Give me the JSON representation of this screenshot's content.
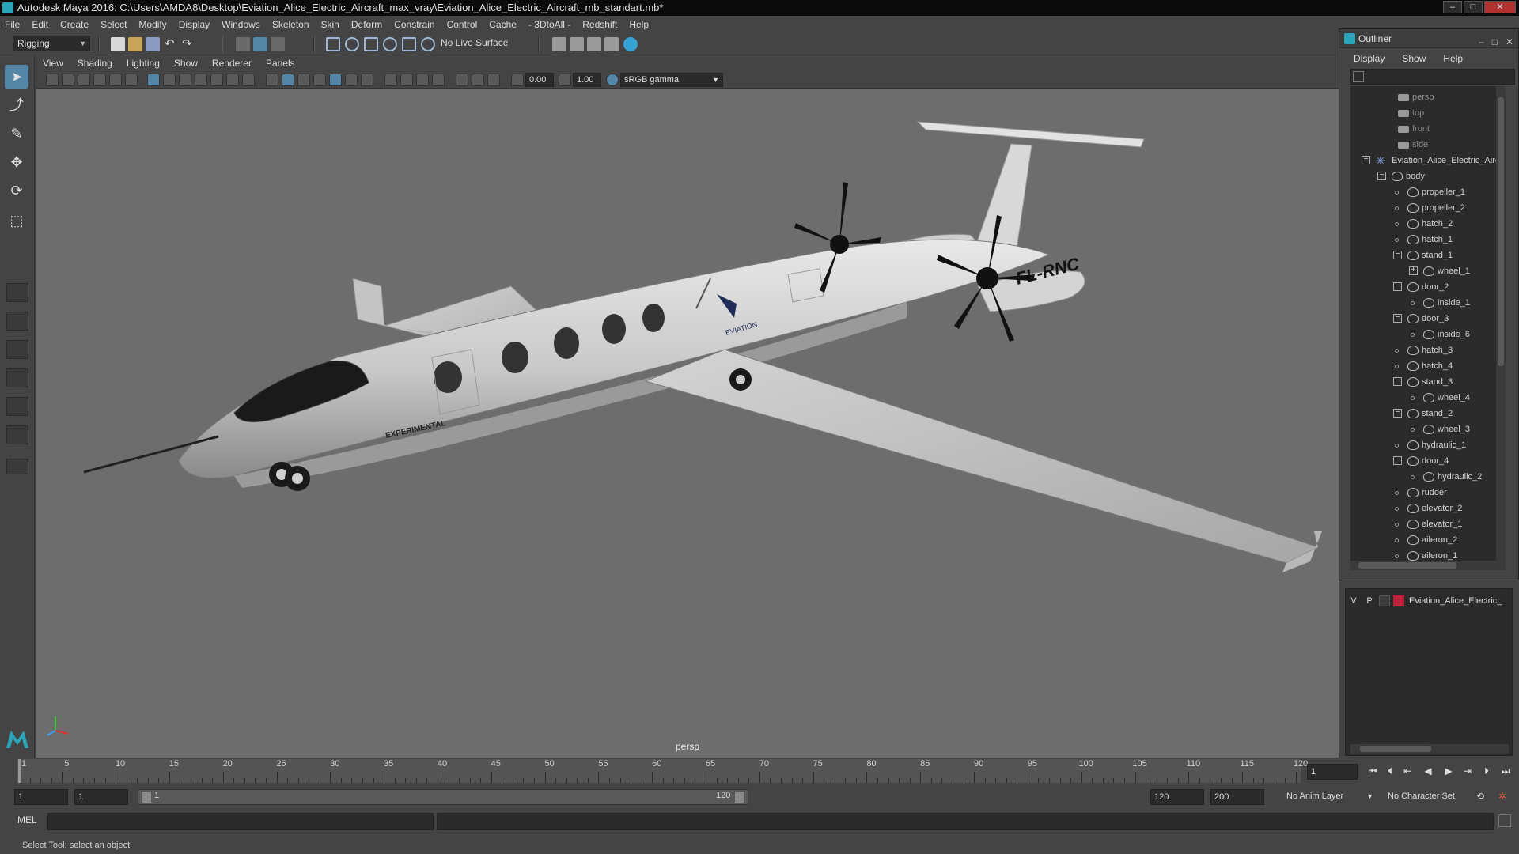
{
  "window": {
    "title": "Autodesk Maya 2016: C:\\Users\\AMDA8\\Desktop\\Eviation_Alice_Electric_Aircraft_max_vray\\Eviation_Alice_Electric_Aircraft_mb_standart.mb*"
  },
  "menus": [
    "File",
    "Edit",
    "Create",
    "Select",
    "Modify",
    "Display",
    "Windows",
    "Skeleton",
    "Skin",
    "Deform",
    "Constrain",
    "Control",
    "Cache",
    "- 3DtoAll -",
    "Redshift",
    "Help"
  ],
  "shelf": {
    "mode": "Rigging",
    "live_surface": "No Live Surface"
  },
  "viewport_menus": [
    "View",
    "Shading",
    "Lighting",
    "Show",
    "Renderer",
    "Panels"
  ],
  "viewport_toolbar": {
    "exposure": "0.00",
    "gamma": "1.00",
    "color_space": "sRGB gamma"
  },
  "viewport": {
    "camera_label": "persp",
    "aircraft_texts": {
      "registration": "FL-RNC",
      "brand": "EVIATION",
      "experimental": "EXPERIMENTAL"
    }
  },
  "outliner": {
    "title": "Outliner",
    "menus": [
      "Display",
      "Show",
      "Help"
    ],
    "items": [
      {
        "label": "persp",
        "type": "camera",
        "indent": 0,
        "expander": ""
      },
      {
        "label": "top",
        "type": "camera",
        "indent": 0,
        "expander": ""
      },
      {
        "label": "front",
        "type": "camera",
        "indent": 0,
        "expander": ""
      },
      {
        "label": "side",
        "type": "camera",
        "indent": 0,
        "expander": ""
      },
      {
        "label": "Eviation_Alice_Electric_Aircraft",
        "type": "group",
        "indent": 0,
        "expander": "−"
      },
      {
        "label": "body",
        "type": "mesh",
        "indent": 1,
        "expander": "−"
      },
      {
        "label": "propeller_1",
        "type": "mesh",
        "indent": 2,
        "expander": ""
      },
      {
        "label": "propeller_2",
        "type": "mesh",
        "indent": 2,
        "expander": ""
      },
      {
        "label": "hatch_2",
        "type": "mesh",
        "indent": 2,
        "expander": ""
      },
      {
        "label": "hatch_1",
        "type": "mesh",
        "indent": 2,
        "expander": ""
      },
      {
        "label": "stand_1",
        "type": "mesh",
        "indent": 2,
        "expander": "−"
      },
      {
        "label": "wheel_1",
        "type": "mesh",
        "indent": 3,
        "expander": "+"
      },
      {
        "label": "door_2",
        "type": "mesh",
        "indent": 2,
        "expander": "−"
      },
      {
        "label": "inside_1",
        "type": "mesh",
        "indent": 3,
        "expander": ""
      },
      {
        "label": "door_3",
        "type": "mesh",
        "indent": 2,
        "expander": "−"
      },
      {
        "label": "inside_6",
        "type": "mesh",
        "indent": 3,
        "expander": ""
      },
      {
        "label": "hatch_3",
        "type": "mesh",
        "indent": 2,
        "expander": ""
      },
      {
        "label": "hatch_4",
        "type": "mesh",
        "indent": 2,
        "expander": ""
      },
      {
        "label": "stand_3",
        "type": "mesh",
        "indent": 2,
        "expander": "−"
      },
      {
        "label": "wheel_4",
        "type": "mesh",
        "indent": 3,
        "expander": ""
      },
      {
        "label": "stand_2",
        "type": "mesh",
        "indent": 2,
        "expander": "−"
      },
      {
        "label": "wheel_3",
        "type": "mesh",
        "indent": 3,
        "expander": ""
      },
      {
        "label": "hydraulic_1",
        "type": "mesh",
        "indent": 2,
        "expander": ""
      },
      {
        "label": "door_4",
        "type": "mesh",
        "indent": 2,
        "expander": "−"
      },
      {
        "label": "hydraulic_2",
        "type": "mesh",
        "indent": 3,
        "expander": ""
      },
      {
        "label": "rudder",
        "type": "mesh",
        "indent": 2,
        "expander": ""
      },
      {
        "label": "elevator_2",
        "type": "mesh",
        "indent": 2,
        "expander": ""
      },
      {
        "label": "elevator_1",
        "type": "mesh",
        "indent": 2,
        "expander": ""
      },
      {
        "label": "aileron_2",
        "type": "mesh",
        "indent": 2,
        "expander": ""
      },
      {
        "label": "aileron_1",
        "type": "mesh",
        "indent": 2,
        "expander": ""
      }
    ]
  },
  "layers": {
    "visible_flag": "V",
    "playback_flag": "P",
    "layer_name": "Eviation_Alice_Electric_",
    "layer_color": "#c0203a"
  },
  "timeline": {
    "tick_labels": [
      "1",
      "5",
      "10",
      "15",
      "20",
      "25",
      "30",
      "35",
      "40",
      "45",
      "50",
      "55",
      "60",
      "65",
      "70",
      "75",
      "80",
      "85",
      "90",
      "95",
      "100",
      "105",
      "110",
      "115",
      "120"
    ],
    "current_frame": "1"
  },
  "range": {
    "start": "1",
    "playback_start": "1",
    "slider_start": "1",
    "slider_end": "120",
    "playback_end": "120",
    "end": "200",
    "anim_layer": "No Anim Layer",
    "character_set": "No Character Set"
  },
  "command_line": {
    "label": "MEL"
  },
  "help_line": "Select Tool: select an object",
  "colors": {
    "accent": "#5285a6",
    "ui_bg": "#444444",
    "viewport_bg": "#6d6d6d"
  }
}
